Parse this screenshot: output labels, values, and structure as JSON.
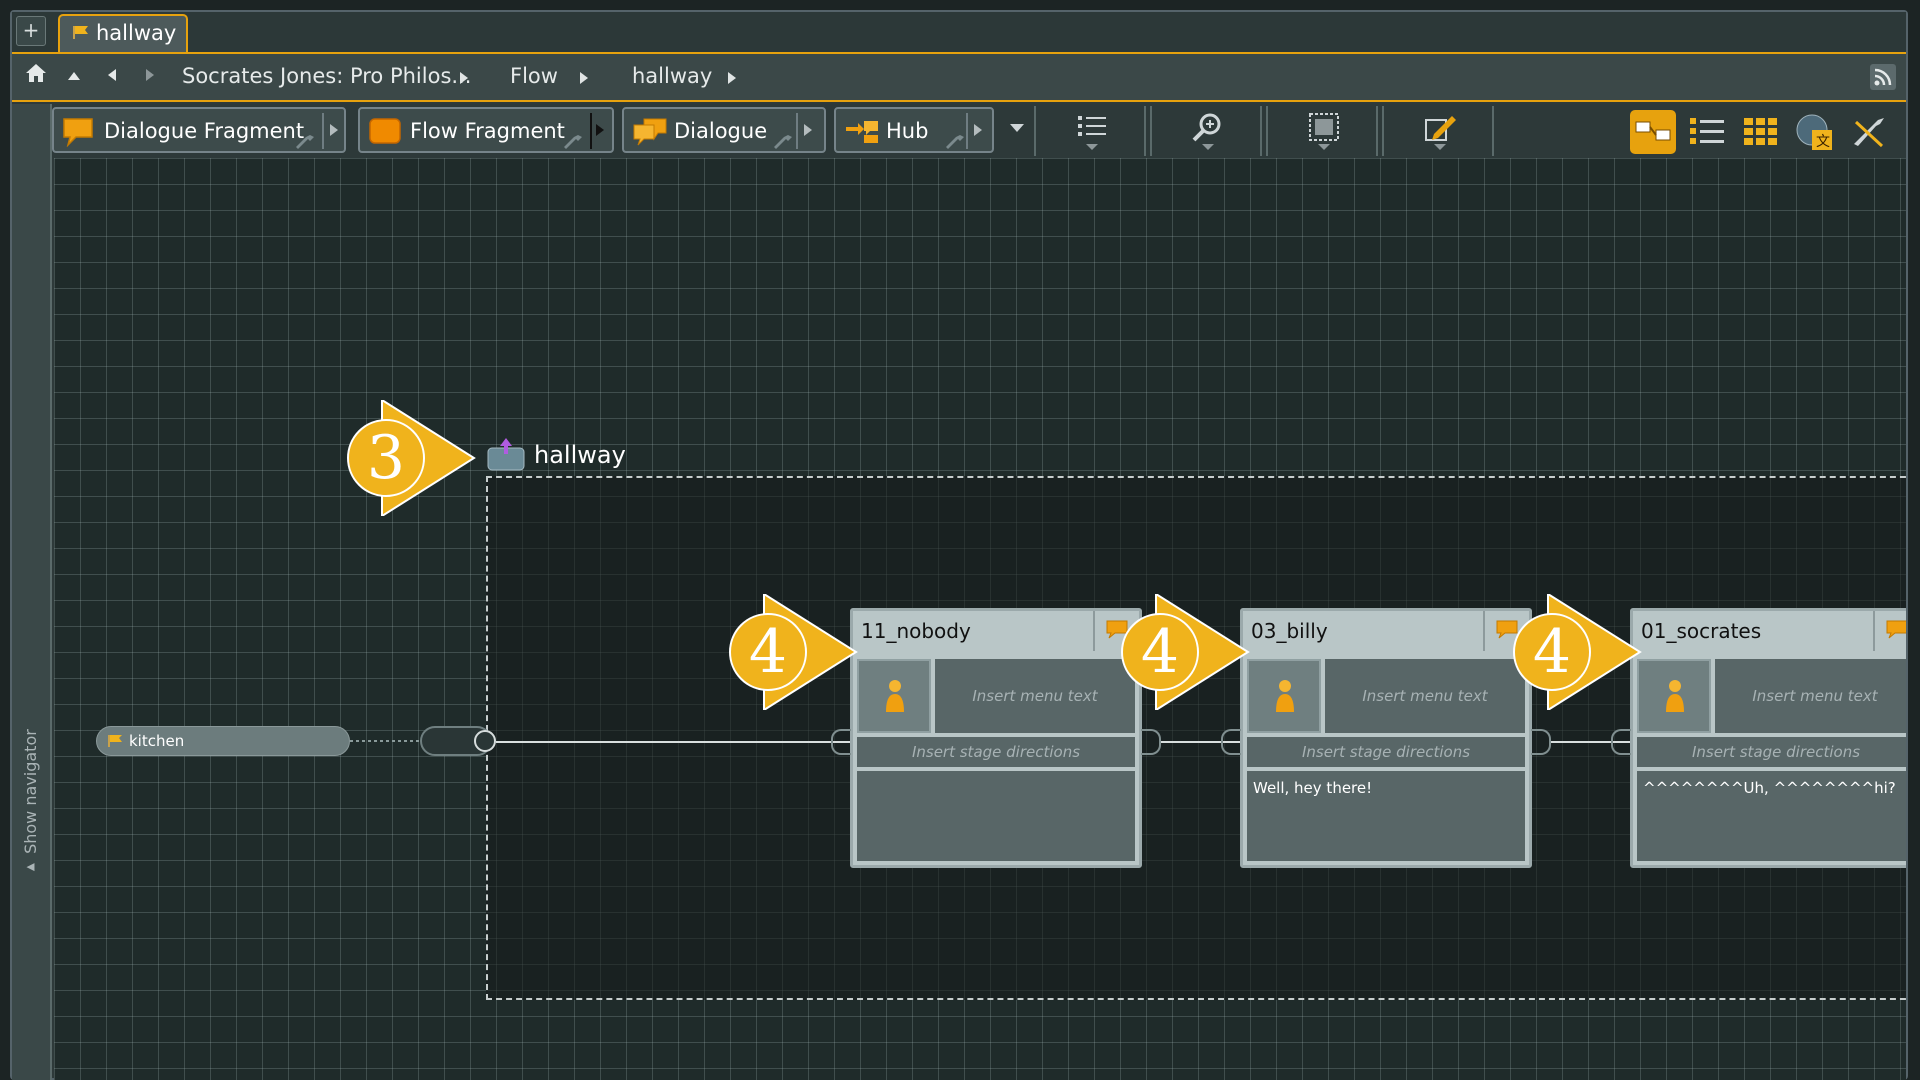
{
  "tabs": [
    {
      "label": "hallway"
    }
  ],
  "breadcrumb": {
    "project": "Socrates Jones: Pro Philos...",
    "section": "Flow",
    "current": "hallway"
  },
  "toolbar": {
    "fragments": [
      {
        "label": "Dialogue Fragment",
        "icon": "dialogue-fragment-icon"
      },
      {
        "label": "Flow Fragment",
        "icon": "flow-fragment-icon"
      },
      {
        "label": "Dialogue",
        "icon": "dialogue-icon"
      },
      {
        "label": "Hub",
        "icon": "hub-icon"
      }
    ],
    "tools": [
      "list-icon",
      "zoom-icon",
      "fit-grid-icon",
      "edit-icon"
    ],
    "views": [
      "flow-view-icon",
      "list-view-icon",
      "grid-view-icon",
      "localization-icon",
      "settings-icon"
    ]
  },
  "navigator": {
    "label": "Show navigator"
  },
  "canvas": {
    "flow_title": "hallway",
    "input_pin_label": "kitchen",
    "callouts": [
      "3",
      "4",
      "4",
      "4"
    ],
    "nodes": [
      {
        "title": "11_nobody",
        "menu_placeholder": "Insert menu text",
        "stage_placeholder": "Insert stage directions",
        "text": ""
      },
      {
        "title": "03_billy",
        "menu_placeholder": "Insert menu text",
        "stage_placeholder": "Insert stage directions",
        "text": "Well, hey there!"
      },
      {
        "title": "01_socrates",
        "menu_placeholder": "Insert menu text",
        "stage_placeholder": "Insert stage directions",
        "text": "^^^^^^^^Uh, ^^^^^^^^hi?"
      }
    ]
  },
  "colors": {
    "accent": "#e7a20e",
    "callout": "#f0b31c",
    "canvas": "#1f2b2a",
    "node": "#b9c6c7"
  }
}
